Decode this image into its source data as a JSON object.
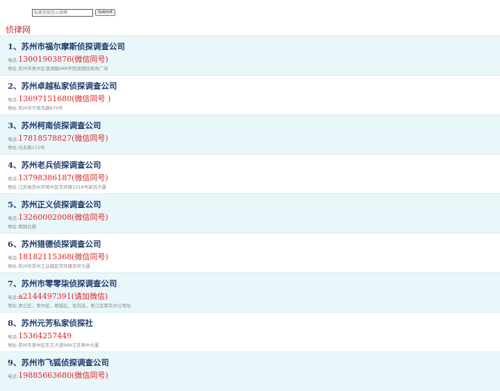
{
  "search": {
    "placeholder": "私家侦探怎么找啊",
    "submit_label": "Submit"
  },
  "site_title": "侦律网",
  "listings": [
    {
      "title": "1、苏州市福尔摩斯侦探调查公司",
      "phone_label": "电话:",
      "phone": "13001903876(微信同号)",
      "address": "地址:苏州市吴中区澄湖路888号恒润国际商务广场"
    },
    {
      "title": "2、苏州卓越私家侦探调查公司",
      "phone_label": "电话:",
      "phone": "13697151680(微信同号 )",
      "address": "地址:苏州市干将东路879号"
    },
    {
      "title": "3、苏州柯南侦探调查公司",
      "phone_label": "电话:",
      "phone": "17818578827(微信同号)",
      "address": "地址:元丰路113号"
    },
    {
      "title": "4、苏州老兵侦探调查公司",
      "phone_label": "电话:",
      "phone": "13798386187(微信同号)",
      "address": "地址:江苏省苏州市吴中区东环路1518号新苏大厦"
    },
    {
      "title": "5、苏州正义侦探调查公司",
      "phone_label": "电话:",
      "phone": "13260002008(微信同号)",
      "address": "地址:南园北路"
    },
    {
      "title": "6、苏州猎德侦探调查公司",
      "phone_label": "电话:",
      "phone": "18182115368(微信同号)",
      "address": "地址:苏州市苏州工业园区东环路东环大厦"
    },
    {
      "title": "7、苏州市零零柒侦探调查公司",
      "phone_label": "电话:",
      "phone": "a2144497391(请加微信)",
      "address": "地址:虎丘区，吴中区，相城区，姑苏区，吴江区都有办公地址"
    },
    {
      "title": "8、苏州元芳私家侦探社",
      "phone_label": "电话:",
      "phone": "15364257449",
      "address": "地址:苏州市吴中区东方大道988江苏吴中大厦"
    },
    {
      "title": "9、苏州市飞狐侦探调查公司",
      "phone_label": "电话:",
      "phone": "19885663680(微信同号)",
      "address": ""
    }
  ]
}
